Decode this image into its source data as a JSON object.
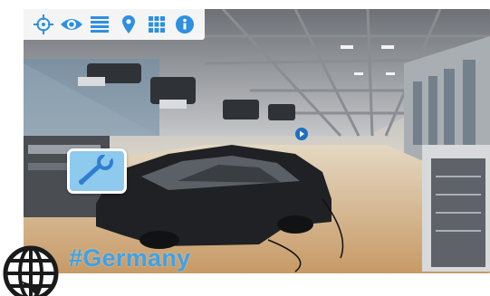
{
  "toolbar": {
    "icons": [
      "crosshair-icon",
      "eye-icon",
      "list-icon",
      "map-pin-icon",
      "grid-icon",
      "info-icon"
    ],
    "accent_color": "#2f8fe0"
  },
  "scene": {
    "description_icon": "factory-assembly-line-photo"
  },
  "badge": {
    "icon": "wrench-icon",
    "background": "#8ec9ee"
  },
  "hashtag": {
    "text": "#Germany",
    "color": "#3da2e8"
  },
  "logo": {
    "icon": "globe-icon"
  }
}
